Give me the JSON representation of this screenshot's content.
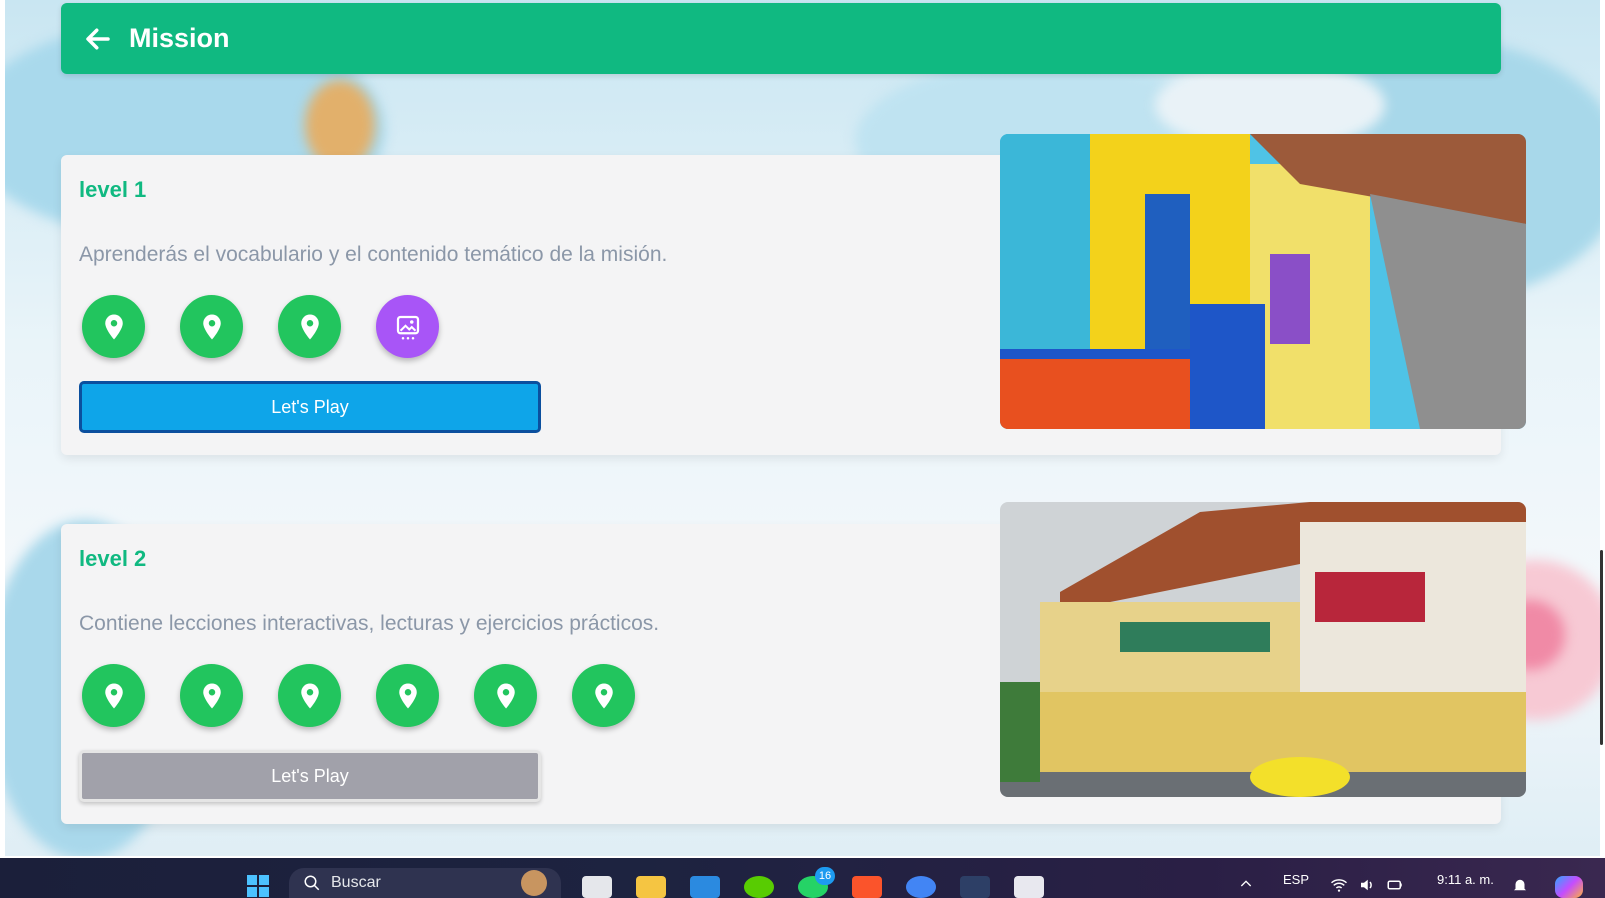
{
  "header": {
    "title": "Mission",
    "back_icon": "arrow-left-icon",
    "color": "#10b981"
  },
  "levels": [
    {
      "title": "level 1",
      "description": "Aprenderás el vocabulario y el contenido temático de la misión.",
      "nodes": [
        "map-pin-icon",
        "map-pin-icon",
        "map-pin-icon",
        "gallery-icon"
      ],
      "button_label": "Let's Play",
      "button_state": "active"
    },
    {
      "title": "level 2",
      "description": "Contiene lecciones interactivas, lecturas y ejercicios prácticos.",
      "nodes": [
        "map-pin-icon",
        "map-pin-icon",
        "map-pin-icon",
        "map-pin-icon",
        "map-pin-icon",
        "map-pin-icon"
      ],
      "button_label": "Let's Play",
      "button_state": "disabled"
    }
  ],
  "taskbar": {
    "search_label": "Buscar",
    "chat_badge": "16",
    "language": "ESP",
    "time": "9:11 a. m."
  },
  "colors": {
    "node_green": "#22c55e",
    "node_purple": "#a855f7",
    "button_blue": "#0ea5e9",
    "button_gray": "#a1a1aa"
  }
}
